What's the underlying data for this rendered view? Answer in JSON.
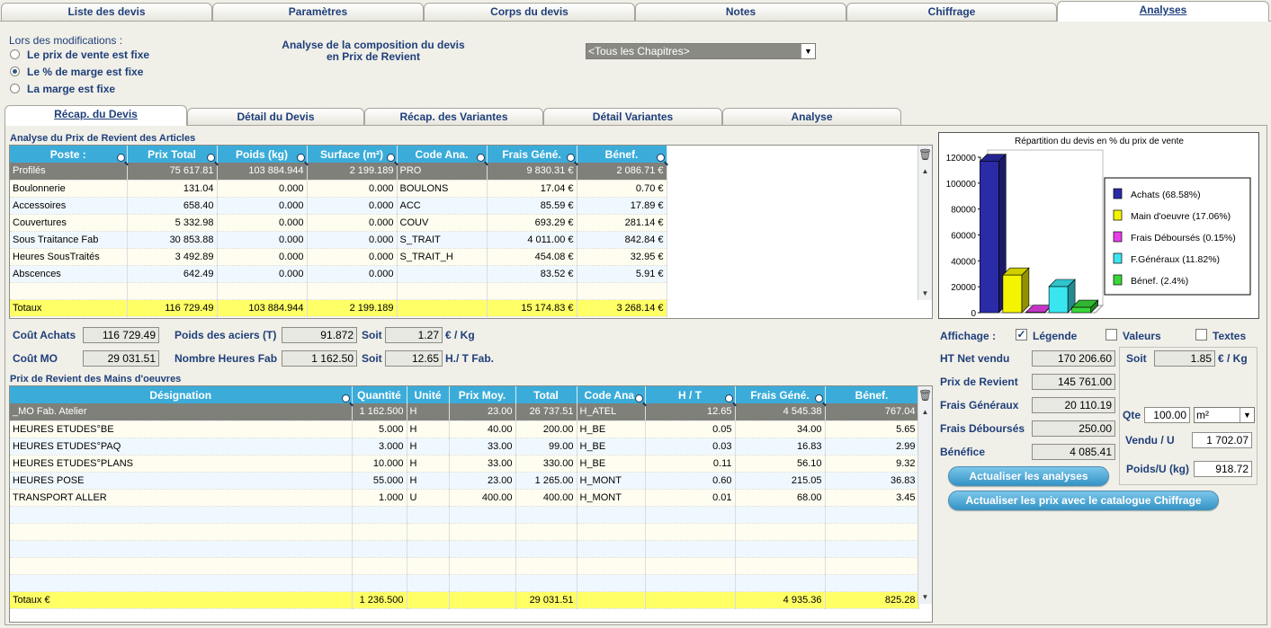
{
  "top_tabs": [
    "Liste des devis",
    "Paramètres",
    "Corps du devis",
    "Notes",
    "Chiffrage",
    "Analyses"
  ],
  "modifications": {
    "title": "Lors des modifications :",
    "options": [
      "Le prix de vente est fixe",
      "Le % de marge est fixe",
      "La marge est fixe"
    ],
    "selected": "Le % de marge est fixe"
  },
  "analysis_title_1": "Analyse de la composition du devis",
  "analysis_title_2": "en Prix de Revient",
  "chapter_select": "<Tous les Chapitres>",
  "sub_tabs": [
    "Récap. du Devis",
    "Détail du Devis",
    "Récap. des Variantes",
    "Détail Variantes",
    "Analyse"
  ],
  "articles": {
    "title": "Analyse du Prix de Revient des Articles",
    "columns": [
      "Poste :",
      "Prix Total",
      "Poids (kg)",
      "Surface (m²)",
      "Code Ana.",
      "Frais Géné.",
      "Bénef."
    ],
    "rows": [
      [
        "Profilés",
        "75 617.81",
        "103 884.944",
        "2 199.189",
        "PRO",
        "9 830.31 €",
        "2 086.71 €"
      ],
      [
        "Boulonnerie",
        "131.04",
        "0.000",
        "0.000",
        "BOULONS",
        "17.04 €",
        "0.70 €"
      ],
      [
        "Accessoires",
        "658.40",
        "0.000",
        "0.000",
        "ACC",
        "85.59 €",
        "17.89 €"
      ],
      [
        "Couvertures",
        "5 332.98",
        "0.000",
        "0.000",
        "COUV",
        "693.29 €",
        "281.14 €"
      ],
      [
        "Sous Traitance Fab",
        "30 853.88",
        "0.000",
        "0.000",
        "S_TRAIT",
        "4 011.00 €",
        "842.84 €"
      ],
      [
        "Heures SousTraités",
        "3 492.89",
        "0.000",
        "0.000",
        "S_TRAIT_H",
        "454.08 €",
        "32.95 €"
      ],
      [
        "Abscences",
        "642.49",
        "0.000",
        "0.000",
        "",
        "83.52 €",
        "5.91 €"
      ]
    ],
    "totals": [
      "Totaux",
      "116 729.49",
      "103 884.944",
      "2 199.189",
      "",
      "15 174.83 €",
      "3 268.14 €"
    ]
  },
  "summary": {
    "cout_achats_label": "Coût Achats",
    "cout_achats": "116 729.49",
    "poids_label": "Poids des aciers (T)",
    "poids": "91.872",
    "soit_label": "Soit",
    "soit_kg": "1.27",
    "unit_kg": "€ / Kg",
    "cout_mo_label": "Coût MO",
    "cout_mo": "29 031.51",
    "heures_label": "Nombre Heures Fab",
    "heures": "1 162.50",
    "soit_h": "12.65",
    "unit_h": "H./ T Fab."
  },
  "labour": {
    "title": "Prix de Revient des Mains d'oeuvres",
    "columns": [
      "Désignation",
      "Quantité",
      "Unité",
      "Prix Moy.",
      "Total",
      "Code Ana.",
      "H / T",
      "Frais Géné.",
      "Bénef."
    ],
    "rows": [
      [
        "_MO Fab. Atelier",
        "1 162.500",
        "H",
        "23.00",
        "26 737.51",
        "H_ATEL",
        "12.65",
        "4 545.38",
        "767.04"
      ],
      [
        "HEURES ETUDES°BE",
        "5.000",
        "H",
        "40.00",
        "200.00",
        "H_BE",
        "0.05",
        "34.00",
        "5.65"
      ],
      [
        "HEURES ETUDES°PAQ",
        "3.000",
        "H",
        "33.00",
        "99.00",
        "H_BE",
        "0.03",
        "16.83",
        "2.99"
      ],
      [
        "HEURES ETUDES°PLANS",
        "10.000",
        "H",
        "33.00",
        "330.00",
        "H_BE",
        "0.11",
        "56.10",
        "9.32"
      ],
      [
        "HEURES POSE",
        "55.000",
        "H",
        "23.00",
        "1 265.00",
        "H_MONT",
        "0.60",
        "215.05",
        "36.83"
      ],
      [
        "TRANSPORT ALLER",
        "1.000",
        "U",
        "400.00",
        "400.00",
        "H_MONT",
        "0.01",
        "68.00",
        "3.45"
      ]
    ],
    "totals": [
      "Totaux €",
      "1 236.500",
      "",
      "",
      "29 031.51",
      "",
      "",
      "4 935.36",
      "825.28"
    ]
  },
  "chart_data": {
    "type": "bar",
    "title": "Répartition du devis en % du prix de vente",
    "categories": [
      "Achats (68.58%)",
      "Main d'oeuvre (17.06%)",
      "Frais Déboursés (0.15%)",
      "F.Généraux (11.82%)",
      "Bénef. (2.4%)"
    ],
    "values": [
      116729.49,
      29031.51,
      250,
      20110.19,
      4085.41
    ],
    "colors": [
      "#2b2ba8",
      "#f4f400",
      "#e83ee8",
      "#39e6f0",
      "#39d639"
    ],
    "yticks": [
      "120000",
      "100000",
      "80000",
      "60000",
      "40000",
      "20000",
      "0"
    ],
    "ylim": [
      0,
      120000
    ],
    "legend": "right"
  },
  "display": {
    "label": "Affichage :",
    "legende": "Légende",
    "valeurs": "Valeurs",
    "textes": "Textes"
  },
  "totals_panel": {
    "ht_label": "HT Net vendu",
    "ht": "170 206.60",
    "pr_label": "Prix de Revient",
    "pr": "145 761.00",
    "fg_label": "Frais Généraux",
    "fg": "20 110.19",
    "fd_label": "Frais Déboursés",
    "fd": "250.00",
    "bn_label": "Bénéfice",
    "bn": "4 085.41",
    "soit_label": "Soit",
    "soit": "1.85",
    "soit_unit": "€ / Kg",
    "qte_label": "Qte",
    "qte": "100.00",
    "qte_unit": "m²",
    "vendu_label": "Vendu / U",
    "vendu": "1 702.07",
    "poids_label": "Poids/U (kg)",
    "poids": "918.72"
  },
  "buttons": {
    "refresh": "Actualiser les analyses",
    "catalog": "Actualiser les prix avec le catalogue Chiffrage"
  }
}
